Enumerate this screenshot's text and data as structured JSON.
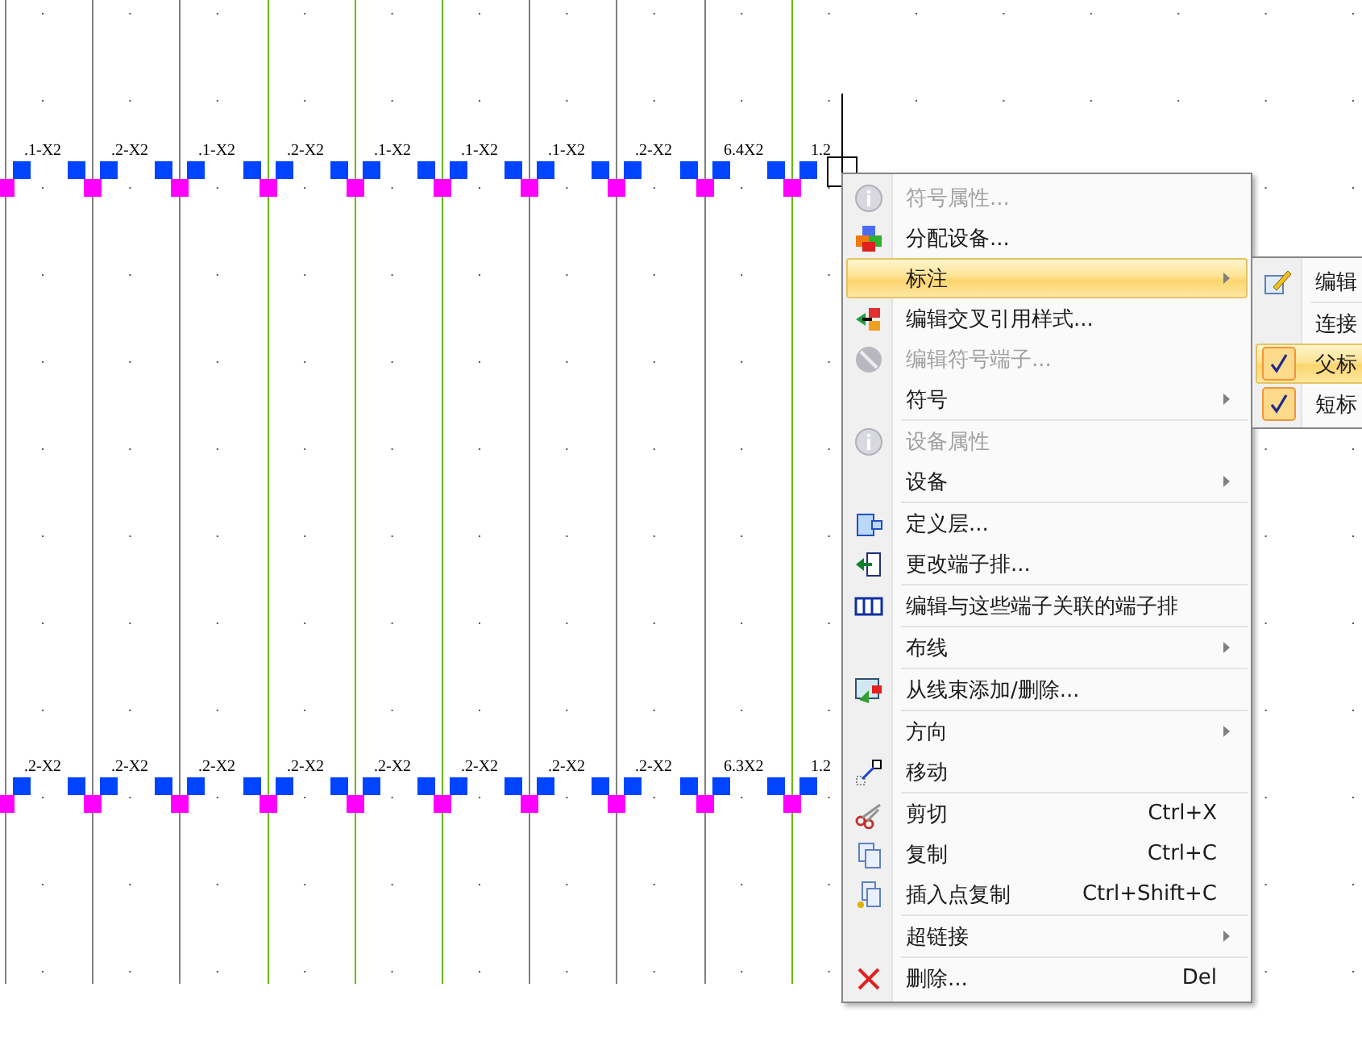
{
  "canvas": {
    "wires": [
      {
        "color": "#808080"
      },
      {
        "color": "#808080"
      },
      {
        "color": "#808080"
      },
      {
        "color": "#66bb00"
      },
      {
        "color": "#66bb00"
      },
      {
        "color": "#66bb00"
      },
      {
        "color": "#808080"
      },
      {
        "color": "#808080"
      },
      {
        "color": "#808080"
      },
      {
        "color": "#66bb00"
      }
    ],
    "top_labels": [
      ".1-X2",
      ".2-X2",
      ".1-X2",
      ".2-X2",
      ".1-X2",
      ".1-X2",
      ".1-X2",
      ".2-X2",
      "6.4X2",
      "1.2"
    ],
    "bottom_labels": [
      ".2-X2",
      ".2-X2",
      ".2-X2",
      ".2-X2",
      ".2-X2",
      ".2-X2",
      ".2-X2",
      ".2-X2",
      "6.3X2",
      "1.2"
    ]
  },
  "context_menu": {
    "items": [
      {
        "kind": "item",
        "label": "符号属性...",
        "disabled": true,
        "selected": false,
        "has_submenu": false
      },
      {
        "kind": "item",
        "label": "分配设备...",
        "disabled": false,
        "selected": false,
        "has_submenu": false
      },
      {
        "kind": "item",
        "label": "标注",
        "disabled": false,
        "selected": true,
        "has_submenu": true
      },
      {
        "kind": "item",
        "label": "编辑交叉引用样式...",
        "disabled": false,
        "selected": false,
        "has_submenu": false
      },
      {
        "kind": "item",
        "label": "编辑符号端子...",
        "disabled": true,
        "selected": false,
        "has_submenu": false
      },
      {
        "kind": "item",
        "label": "符号",
        "disabled": false,
        "selected": false,
        "has_submenu": true
      },
      {
        "kind": "separator"
      },
      {
        "kind": "item",
        "label": "设备属性",
        "disabled": true,
        "selected": false,
        "has_submenu": false
      },
      {
        "kind": "item",
        "label": "设备",
        "disabled": false,
        "selected": false,
        "has_submenu": true
      },
      {
        "kind": "separator"
      },
      {
        "kind": "item",
        "label": "定义层...",
        "disabled": false,
        "selected": false,
        "has_submenu": false
      },
      {
        "kind": "item",
        "label": "更改端子排...",
        "disabled": false,
        "selected": false,
        "has_submenu": false
      },
      {
        "kind": "separator"
      },
      {
        "kind": "item",
        "label": "编辑与这些端子关联的端子排",
        "disabled": false,
        "selected": false,
        "has_submenu": false
      },
      {
        "kind": "separator"
      },
      {
        "kind": "item",
        "label": "布线",
        "disabled": false,
        "selected": false,
        "has_submenu": true
      },
      {
        "kind": "separator"
      },
      {
        "kind": "item",
        "label": "从线束添加/删除...",
        "disabled": false,
        "selected": false,
        "has_submenu": false
      },
      {
        "kind": "separator"
      },
      {
        "kind": "item",
        "label": "方向",
        "disabled": false,
        "selected": false,
        "has_submenu": true
      },
      {
        "kind": "item",
        "label": "移动",
        "disabled": false,
        "selected": false,
        "has_submenu": false
      },
      {
        "kind": "separator"
      },
      {
        "kind": "item",
        "label": "剪切",
        "shortcut": "Ctrl+X",
        "disabled": false,
        "selected": false,
        "has_submenu": false
      },
      {
        "kind": "item",
        "label": "复制",
        "shortcut": "Ctrl+C",
        "disabled": false,
        "selected": false,
        "has_submenu": false
      },
      {
        "kind": "item",
        "label": "插入点复制",
        "shortcut": "Ctrl+Shift+C",
        "disabled": false,
        "selected": false,
        "has_submenu": false
      },
      {
        "kind": "separator"
      },
      {
        "kind": "item",
        "label": "超链接",
        "disabled": false,
        "selected": false,
        "has_submenu": true
      },
      {
        "kind": "separator"
      },
      {
        "kind": "item",
        "label": "删除...",
        "shortcut": "Del",
        "disabled": false,
        "selected": false,
        "has_submenu": false
      }
    ]
  },
  "submenu": {
    "items": [
      {
        "kind": "icon-item",
        "label": "编辑"
      },
      {
        "kind": "separator"
      },
      {
        "kind": "item",
        "label": "连接"
      },
      {
        "kind": "check-item",
        "label": "父标",
        "checked": true,
        "selected": true
      },
      {
        "kind": "check-item",
        "label": "短标",
        "checked": true,
        "selected": false
      }
    ]
  }
}
